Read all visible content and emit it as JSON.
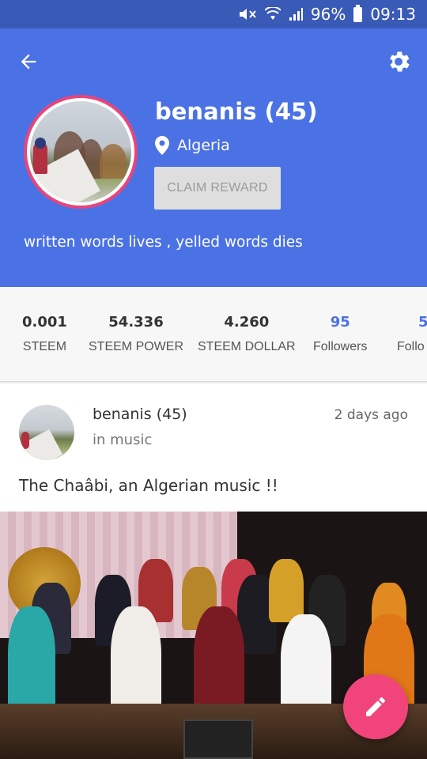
{
  "status_bar": {
    "battery": "96%",
    "time": "09:13"
  },
  "profile": {
    "username": "benanis (45)",
    "location": "Algeria",
    "claim_label": "CLAIM REWARD",
    "bio": "written words lives , yelled words dies"
  },
  "stats": [
    {
      "value": "0.001",
      "label": "STEEM"
    },
    {
      "value": "54.336",
      "label": "STEEM POWER"
    },
    {
      "value": "4.260",
      "label": "STEEM DOLLAR"
    },
    {
      "value": "95",
      "label": "Followers"
    },
    {
      "value": "5",
      "label": "Follo"
    }
  ],
  "post": {
    "author": "benanis (45)",
    "category": "in music",
    "time": "2 days ago",
    "title": "The Chaâbi, an Algerian music !!"
  },
  "colors": {
    "header": "#4b72e5",
    "status_bar": "#3a5ab8",
    "accent": "#f0447a",
    "link": "#4b72e5"
  },
  "icons": {
    "back": "arrow-left-icon",
    "settings": "gear-icon",
    "location": "map-pin-icon",
    "fab": "pencil-icon"
  }
}
